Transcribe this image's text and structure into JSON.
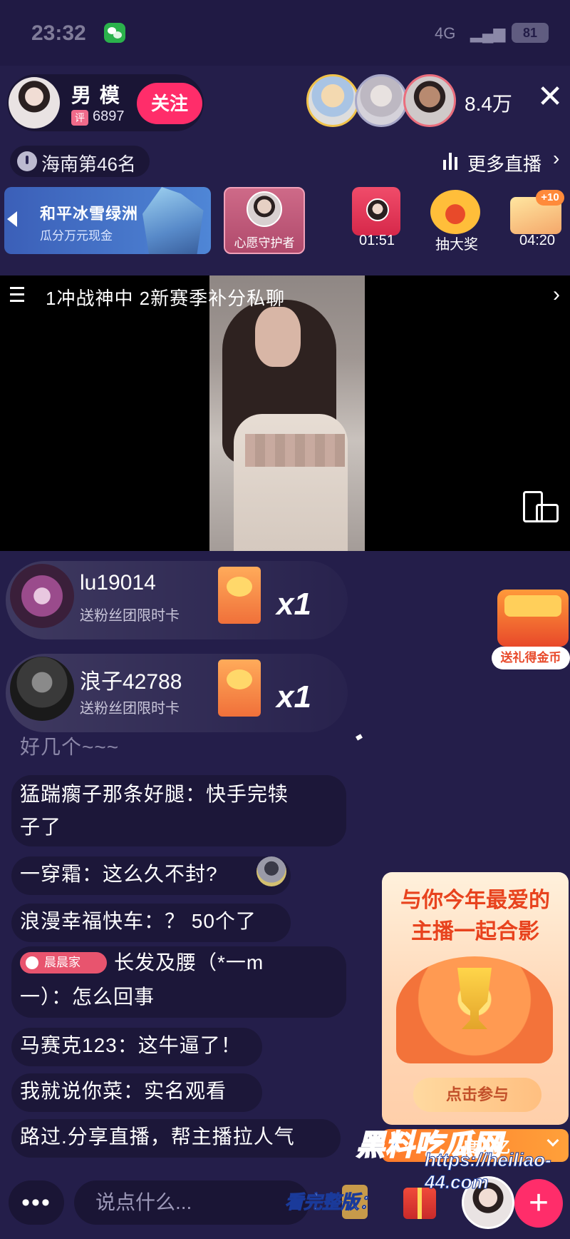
{
  "status_bar": {
    "time": "23:32",
    "signal": "4G",
    "battery": "81"
  },
  "host": {
    "name": "男 模",
    "badge": "评",
    "likes": "6897",
    "follow_label": "关注"
  },
  "viewers": {
    "count": "8.4万",
    "close_label": "✕"
  },
  "rank": {
    "text": "海南第46名",
    "more_live": "更多直播"
  },
  "activities": {
    "banner_title": "和平冰雪绿洲",
    "banner_subtitle": "瓜分万元现金",
    "guard_label": "心愿守护者",
    "timer_1": "01:51",
    "lottery_label": "抽大奖",
    "plus_badge": "+10",
    "timer_2": "04:20"
  },
  "video": {
    "ticker": "1冲战神中   2新赛季补分私聊"
  },
  "gifts": [
    {
      "user": "lu19014",
      "desc": "送粉丝团限时卡",
      "count": "x1"
    },
    {
      "user": "浪子42788",
      "desc": "送粉丝团限时卡",
      "count": "x1"
    }
  ],
  "gift_chest_label": "送礼得金币",
  "chat": {
    "m0": "好几个~~~",
    "m1a": "猛踹瘸子那条好腿：快手完犊",
    "m1b": "子了",
    "m2": "一穿霜：这么久不封?",
    "m3": "浪漫幸福快车：？ 50个了",
    "fans_badge": "晨晨家",
    "m4a": "长发及腰（*一m",
    "m4b": "一）：怎么回事",
    "m5": "马赛克123：这牛逼了！",
    "m6": "我就说你菜：实名观看",
    "m7": "路过.分享直播，帮主播拉人气"
  },
  "promo": {
    "title_line1": "与你今年最爱的",
    "title_line2": "主播一起合影",
    "button": "点击参与",
    "review": "度回忆"
  },
  "bottom": {
    "more": "•••",
    "input_placeholder": "说点什么...",
    "add": "+"
  },
  "watermark": {
    "logo": "黑料吃瓜网",
    "url": "https://heiliao-44.com",
    "caption": "看完整版："
  }
}
